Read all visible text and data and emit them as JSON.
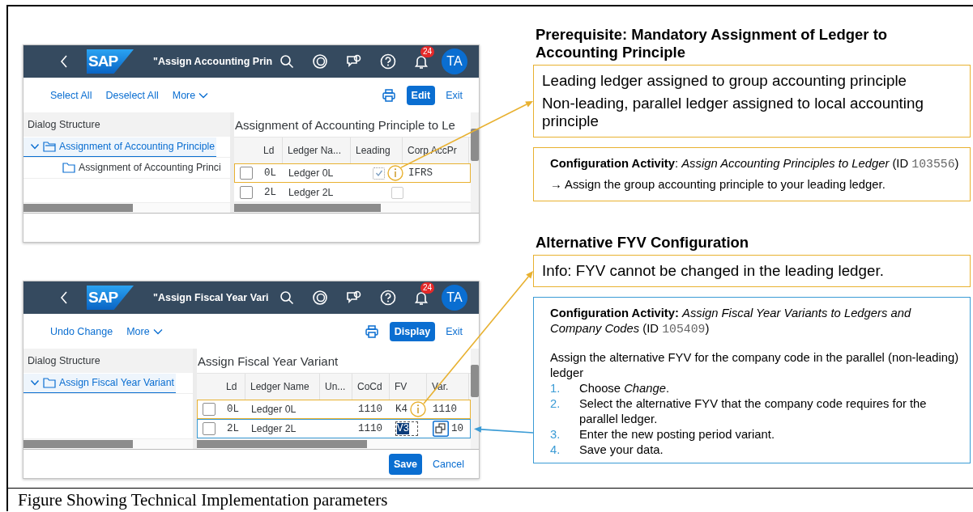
{
  "figure": {
    "windows": [
      {
        "logo": "SAP",
        "title": "\"Assign Accounting Prin",
        "notification_count": "24",
        "avatar": "TA",
        "toolbar_links": [
          {
            "label": "Select All",
            "kind": "link"
          },
          {
            "label": "Deselect All",
            "kind": "link"
          },
          {
            "label": "More",
            "kind": "menu"
          }
        ],
        "primary_button": "Edit",
        "exit": "Exit",
        "tree": {
          "header": "Dialog Structure",
          "items": [
            {
              "label": "Assignment of Accounting Principle",
              "expanded": true,
              "selected": true,
              "children": [
                {
                  "label": "Assignment of Accounting Princi",
                  "selected": false
                }
              ]
            }
          ]
        },
        "table": {
          "title": "Assignment of Accounting Principle to Le",
          "columns": [
            "Ld",
            "Ledger Na...",
            "Leading",
            "Corp AccPr"
          ],
          "rows": [
            {
              "checked": false,
              "color": "#e8b130",
              "cells": [
                {
                  "kind": "mono",
                  "text": "0L"
                },
                {
                  "kind": "text",
                  "text": "Ledger 0L"
                },
                {
                  "kind": "check_info",
                  "checked": true
                },
                {
                  "kind": "mono",
                  "text": "IFRS"
                }
              ]
            },
            {
              "checked": false,
              "cells": [
                {
                  "kind": "mono",
                  "text": "2L"
                },
                {
                  "kind": "text",
                  "text": "Ledger 2L"
                },
                {
                  "kind": "check",
                  "checked": false
                },
                {
                  "kind": "empty"
                }
              ]
            }
          ]
        }
      },
      {
        "logo": "SAP",
        "title": "\"Assign Fiscal Year Vari",
        "notification_count": "24",
        "avatar": "TA",
        "toolbar_links": [
          {
            "label": "Undo Change",
            "kind": "link"
          },
          {
            "label": "More",
            "kind": "menu"
          }
        ],
        "primary_button": "Display",
        "exit": "Exit",
        "tree": {
          "header": "Dialog Structure",
          "items": [
            {
              "label": "Assign Fiscal Year Variant",
              "expanded": true,
              "selected": true
            }
          ]
        },
        "table": {
          "title": "Assign Fiscal Year Variant",
          "columns": [
            "Ld",
            "Ledger Name",
            "Un...",
            "CoCd",
            "FV",
            "Var."
          ],
          "rows": [
            {
              "checked": false,
              "color": "#e8b130",
              "cells": [
                {
                  "kind": "mono",
                  "text": "0L"
                },
                {
                  "kind": "text",
                  "text": "Ledger 0L"
                },
                {
                  "kind": "empty"
                },
                {
                  "kind": "mono",
                  "text": "1110"
                },
                {
                  "kind": "mono_info",
                  "text": "K4"
                },
                {
                  "kind": "mono",
                  "text": "1110"
                }
              ]
            },
            {
              "checked": false,
              "color": "#3a9bd5",
              "cells": [
                {
                  "kind": "mono",
                  "text": "2L"
                },
                {
                  "kind": "text",
                  "text": "Ledger 2L"
                },
                {
                  "kind": "empty"
                },
                {
                  "kind": "mono",
                  "text": "1110"
                },
                {
                  "kind": "edit",
                  "text": "V3"
                },
                {
                  "kind": "help_mono",
                  "text": "10"
                }
              ]
            }
          ]
        },
        "footer": [
          {
            "label": "Save",
            "kind": "primary"
          },
          {
            "label": "Cancel",
            "kind": "link"
          }
        ]
      }
    ],
    "panels": [
      {
        "heading": "Prerequisite: Mandatory Assignment of Ledger to Accounting Principle",
        "boxes": [
          {
            "kind": "statements",
            "color": "#e8b130",
            "lines": [
              "Leading ledger assigned to group accounting principle",
              "Non-leading, parallel ledger assigned to local accounting principle"
            ]
          },
          {
            "kind": "activity",
            "color": "#e8b130",
            "activity": {
              "lead": "**Configuration Activity**: *Assign Accounting Principles to Ledger* (ID ",
              "id": "103556",
              "tail": ")"
            },
            "lines": [
              "→ Assign the group accounting principle to your leading ledger."
            ]
          }
        ]
      },
      {
        "heading": "Alternative FYV Configuration",
        "boxes": [
          {
            "kind": "statements",
            "color": "#e8b130",
            "lines": [
              "Info: FYV cannot be changed in the leading ledger."
            ]
          },
          {
            "kind": "activity",
            "color": "#3a9bd5",
            "activity": {
              "lead": "**Configuration Activity:** *Assign Fiscal Year Variants to Ledgers and Company Codes* (ID ",
              "id": "105409",
              "tail": ")"
            },
            "lines": [
              "Assign the alternative FYV for the company code in the parallel (non-leading) ledger"
            ],
            "steps": [
              {
                "number": "1.",
                "text": "Choose *Change*."
              },
              {
                "number": "2.",
                "text": "Select the alternative FYV that the company code requires for the parallel ledger."
              },
              {
                "number": "3.",
                "text": "Enter the new posting period variant."
              },
              {
                "number": "4.",
                "text": "Save your data."
              }
            ]
          }
        ]
      }
    ]
  },
  "caption": "Figure Showing Technical Implementation parameters"
}
